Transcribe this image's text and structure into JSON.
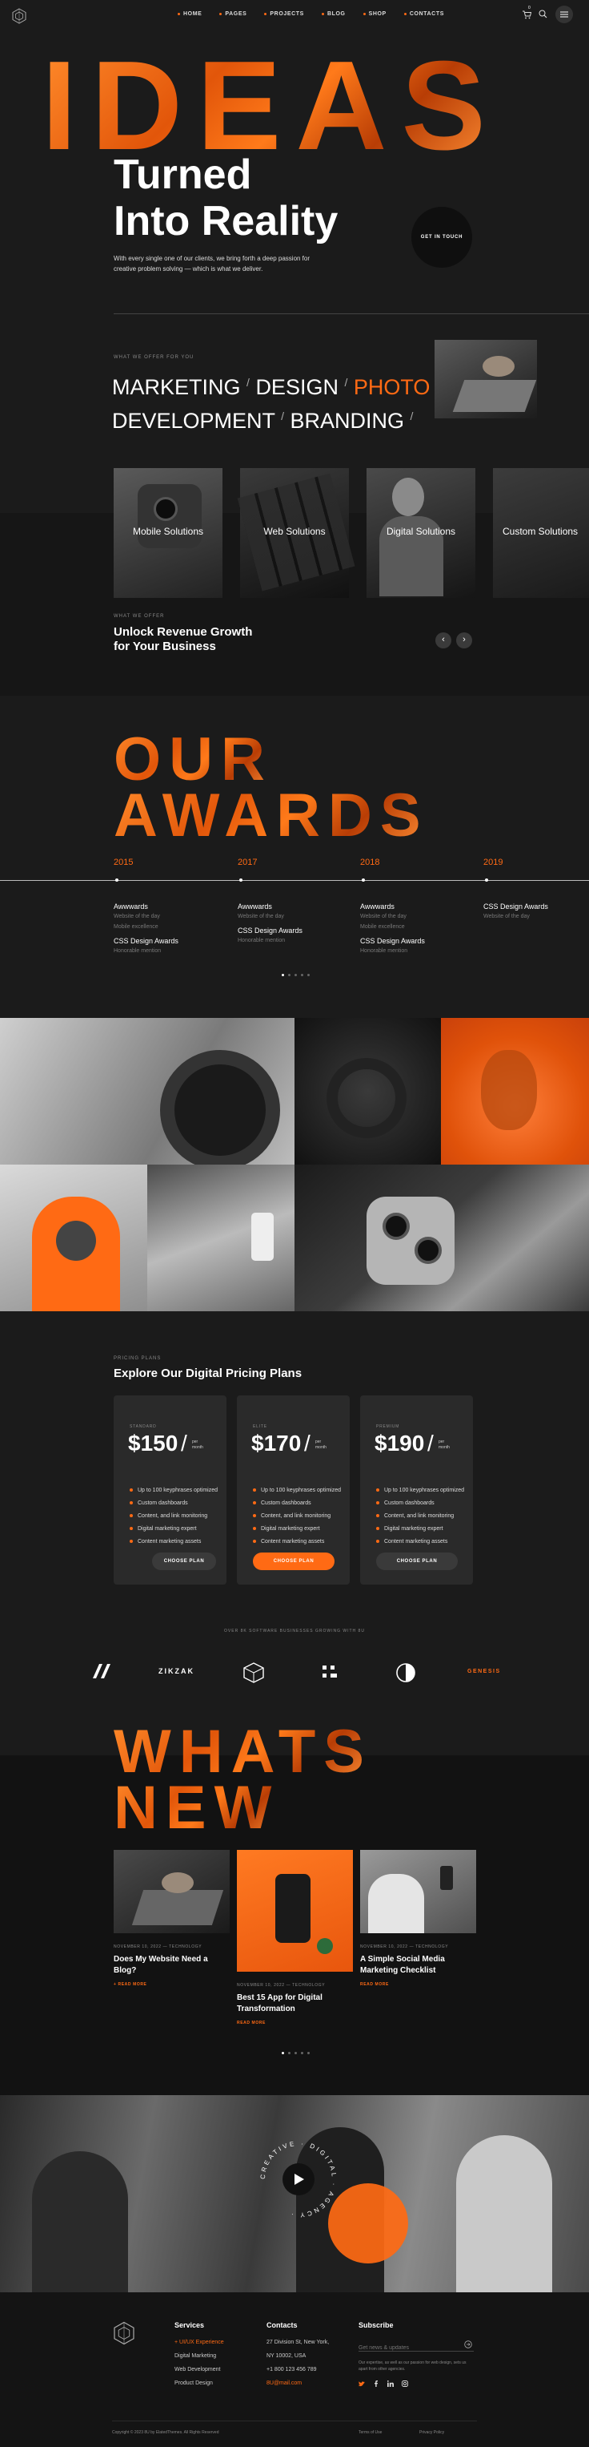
{
  "nav": {
    "items": [
      "HOME",
      "PAGES",
      "PROJECTS",
      "BLOG",
      "SHOP",
      "CONTACTS"
    ],
    "cart_count": "0"
  },
  "hero": {
    "big_word": "IDEAS",
    "line1": "Turned",
    "line2": "Into Reality",
    "description": "With every single one of our clients, we bring forth a deep passion for creative problem solving — which is what we deliver.",
    "cta": "GET IN TOUCH"
  },
  "offer": {
    "eyebrow": "WHAT WE OFFER FOR YOU",
    "row1": [
      "MARKETING",
      "DESIGN",
      "PHOTO"
    ],
    "row2": [
      "DEVELOPMENT",
      "BRANDING"
    ],
    "separator": "/"
  },
  "services": {
    "cards": [
      "Mobile Solutions",
      "Web Solutions",
      "Digital Solutions",
      "Custom Solutions"
    ],
    "eyebrow": "WHAT WE OFFER",
    "heading_line1": "Unlock Revenue Growth",
    "heading_line2": "for Your Business",
    "prev": "‹",
    "next": "›"
  },
  "awards": {
    "title_line1": "OUR",
    "title_line2": "AWARDS",
    "years": [
      {
        "year": "2015",
        "items": [
          {
            "name": "Awwwards",
            "sub": "Website of the day"
          },
          {
            "name": "",
            "sub": "Mobile excellence"
          },
          {
            "name": "CSS Design Awards",
            "sub": "Honorable mention"
          }
        ]
      },
      {
        "year": "2017",
        "items": [
          {
            "name": "Awwwards",
            "sub": "Website of the day"
          },
          {
            "name": "CSS Design Awards",
            "sub": "Honorable mention"
          }
        ]
      },
      {
        "year": "2018",
        "items": [
          {
            "name": "Awwwards",
            "sub": "Website of the day"
          },
          {
            "name": "",
            "sub": "Mobile excellence"
          },
          {
            "name": "CSS Design Awards",
            "sub": "Honorable mention"
          }
        ]
      },
      {
        "year": "2019",
        "items": [
          {
            "name": "CSS Design Awards",
            "sub": "Website of the day"
          }
        ]
      }
    ]
  },
  "pricing": {
    "eyebrow": "PRICING PLANS",
    "title": "Explore Our Digital Pricing Plans",
    "plans": [
      {
        "tier": "STANDARD",
        "price": "$150",
        "per_line1": "per",
        "per_line2": "month",
        "button": "CHOOSE PLAN"
      },
      {
        "tier": "ELITE",
        "price": "$170",
        "per_line1": "per",
        "per_line2": "month",
        "button": "CHOOSE PLAN"
      },
      {
        "tier": "PREMIUM",
        "price": "$190",
        "per_line1": "per",
        "per_line2": "month",
        "button": "CHOOSE PLAN"
      }
    ],
    "features": [
      "Up to 100 keyphrases optimized",
      "Custom dashboards",
      "Content, and link monitoring",
      "Digital marketing expert",
      "Content marketing assets"
    ]
  },
  "clients": {
    "caption": "OVER 8K SOFTWARE BUSINESSES GROWING WITH 8U",
    "logos": [
      "ZIKZAK",
      "GENESIS"
    ]
  },
  "news": {
    "title_line1": "WHATS",
    "title_line2": "NEW",
    "posts": [
      {
        "meta": "NOVEMBER 10, 2022 — TECHNOLOGY",
        "title_line1": "Does My Website Need a",
        "title_line2": "Blog?",
        "more": "READ MORE"
      },
      {
        "meta": "NOVEMBER 10, 2022 — TECHNOLOGY",
        "title_line1": "Best 15 App for Digital",
        "title_line2": "Transformation",
        "more": "READ MORE"
      },
      {
        "meta": "NOVEMBER 10, 2022 — TECHNOLOGY",
        "title_line1": "A Simple Social Media",
        "title_line2": "Marketing Checklist",
        "more": "READ MORE"
      }
    ]
  },
  "video": {
    "ring_text": "CREATIVE · DIGITAL · AGENCY · "
  },
  "footer": {
    "services_head": "Services",
    "services": [
      "UI/UX Experience",
      "Digital Marketing",
      "Web Development",
      "Product Design"
    ],
    "contacts_head": "Contacts",
    "address1": "27 Division St, New York,",
    "address2": "NY 10002, USA",
    "phone": "+1 800 123 456 789",
    "email": "8U@mail.com",
    "subscribe_head": "Subscribe",
    "subscribe_placeholder": "Get news & updates",
    "subscribe_note": "Our expertise, as well as our passion for web design, sets us apart from other agencies.",
    "copyright": "Copyright © 2023 8U by ElatedThemes. All Rights Reserved",
    "terms": "Terms of Use",
    "privacy": "Privacy Policy"
  },
  "colors": {
    "accent": "#ff6a14",
    "background": "#1b1b1b"
  }
}
